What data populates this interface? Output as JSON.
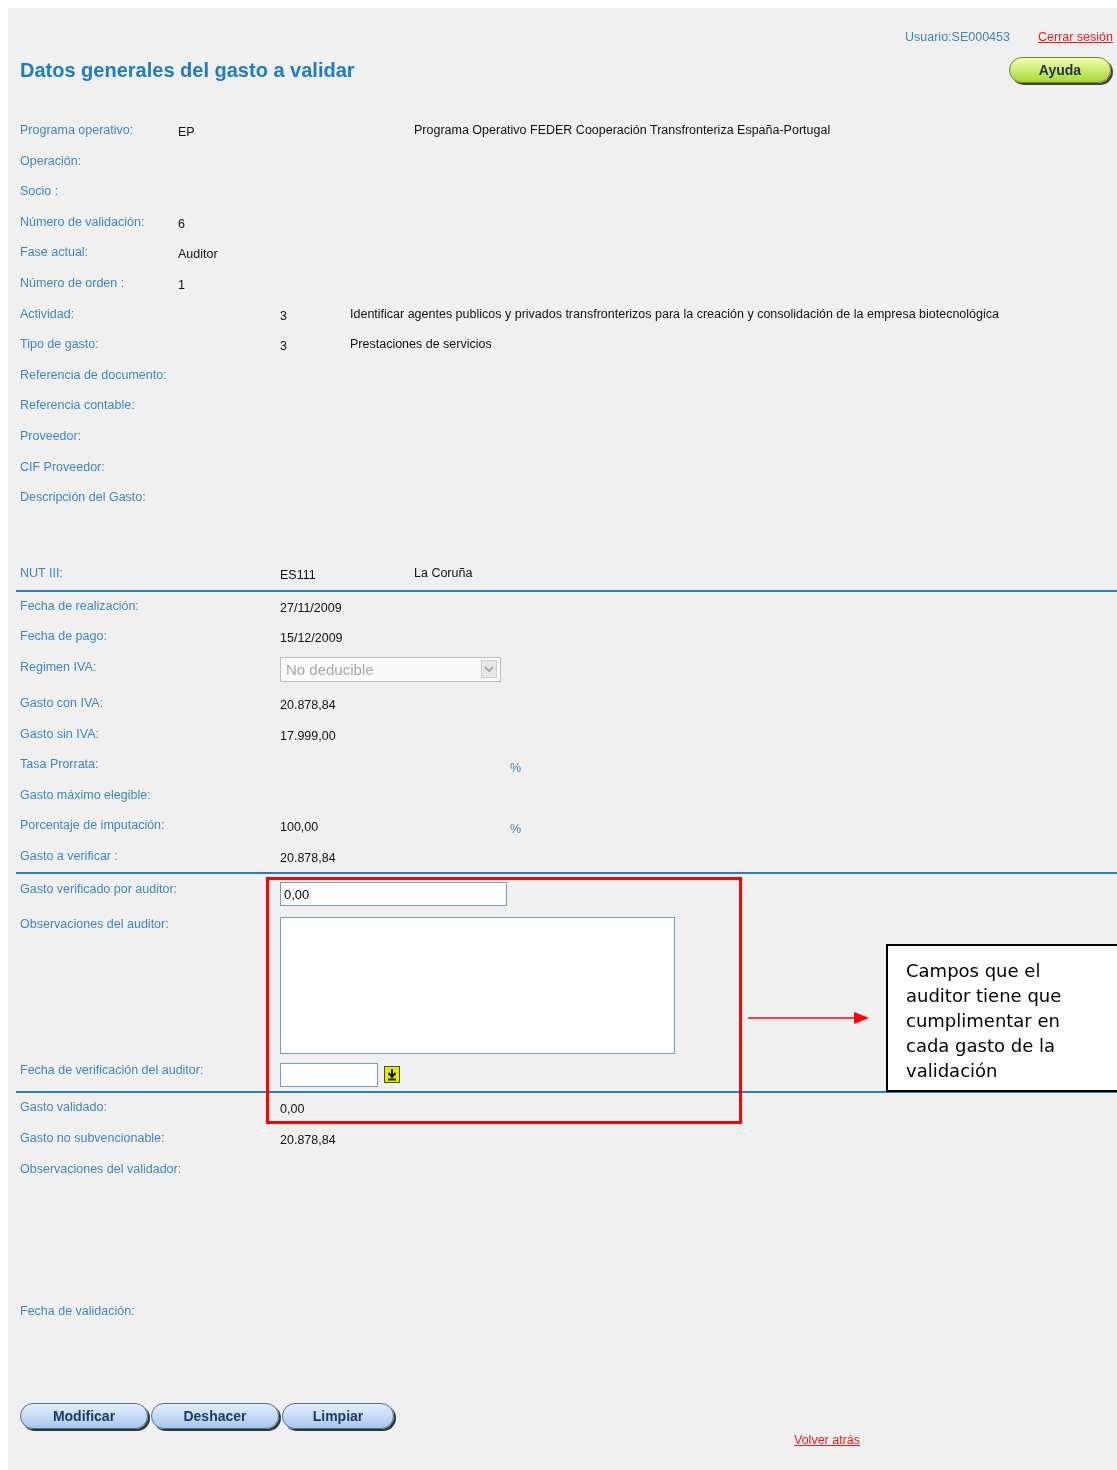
{
  "header": {
    "user": "Usuario:SE000453",
    "logout": "Cerrar sesión",
    "title": "Datos generales del gasto a validar",
    "help_button": "Ayuda"
  },
  "sections": [
    {
      "rows": [
        {
          "kind": "near",
          "label": "Programa operativo:",
          "value": "EP",
          "description": "Programa Operativo FEDER Cooperación Transfronteriza España-Portugal"
        },
        {
          "kind": "near",
          "label": "Operación:"
        },
        {
          "kind": "near",
          "label": "Socio :"
        },
        {
          "kind": "near",
          "label": "Número de validación:",
          "value": "6"
        },
        {
          "kind": "near",
          "label": "Fase actual:",
          "value": "Auditor"
        },
        {
          "kind": "near",
          "label": "Número de orden :",
          "value": "1"
        },
        {
          "kind": "far",
          "label": "Actividad:",
          "value": "3",
          "description": "Identificar agentes publicos y privados transfronterizos para la creación y consolidación de la empresa biotecnológica"
        },
        {
          "kind": "far",
          "label": "Tipo de gasto:",
          "value": "3",
          "description": "Prestaciones de servicios"
        },
        {
          "kind": "far",
          "label": "Referencia de documento:"
        },
        {
          "kind": "far",
          "label": "Referencia contable:"
        },
        {
          "kind": "far",
          "label": "Proveedor:"
        },
        {
          "kind": "far",
          "label": "CIF Proveedor:"
        },
        {
          "kind": "area",
          "label": "Descripción del Gasto:"
        },
        {
          "kind": "far-wide",
          "label": "NUT III:",
          "value": "ES111",
          "description": "La Coruña"
        }
      ]
    },
    {
      "rows": [
        {
          "kind": "far",
          "label": "Fecha de realización:",
          "value": "27/11/2009"
        },
        {
          "kind": "far",
          "label": "Fecha de pago:",
          "value": "15/12/2009"
        },
        {
          "kind": "select",
          "label": "Regimen IVA:",
          "value": "No deducible",
          "disabled": true
        },
        {
          "kind": "far",
          "label": "Gasto con IVA:",
          "value": "20.878,84"
        },
        {
          "kind": "far",
          "label": "Gasto sin IVA:",
          "value": "17.999,00"
        },
        {
          "kind": "percent",
          "label": "Tasa Prorrata:",
          "unit": "%"
        },
        {
          "kind": "far",
          "label": "Gasto máximo elegible:"
        },
        {
          "kind": "percent",
          "label": "Porcentaje de imputación:",
          "value": "100,00",
          "unit": "%"
        },
        {
          "kind": "far",
          "label": "Gasto a verificar :",
          "value": "20.878,84"
        }
      ]
    },
    {
      "rows": [
        {
          "kind": "input",
          "label": "Gasto verificado por auditor:",
          "value": "0,00"
        },
        {
          "kind": "textarea",
          "label": "Observaciones del auditor:"
        },
        {
          "kind": "date",
          "label": "Fecha de verificación del auditor:"
        }
      ]
    },
    {
      "rows": [
        {
          "kind": "far",
          "label": "Gasto validado:",
          "value": "0,00"
        },
        {
          "kind": "far",
          "label": "Gasto no subvencionable:",
          "value": "20.878,84"
        },
        {
          "kind": "area-large",
          "label": "Observaciones del validador:"
        },
        {
          "kind": "far",
          "label": "Fecha de validación:"
        }
      ]
    }
  ],
  "buttons": [
    "Modificar",
    "Deshacer",
    "Limpiar"
  ],
  "back_link": "Volver atrás",
  "annotation": {
    "text": "Campos que el auditor tiene que cumplimentar en cada gasto de la validación"
  }
}
